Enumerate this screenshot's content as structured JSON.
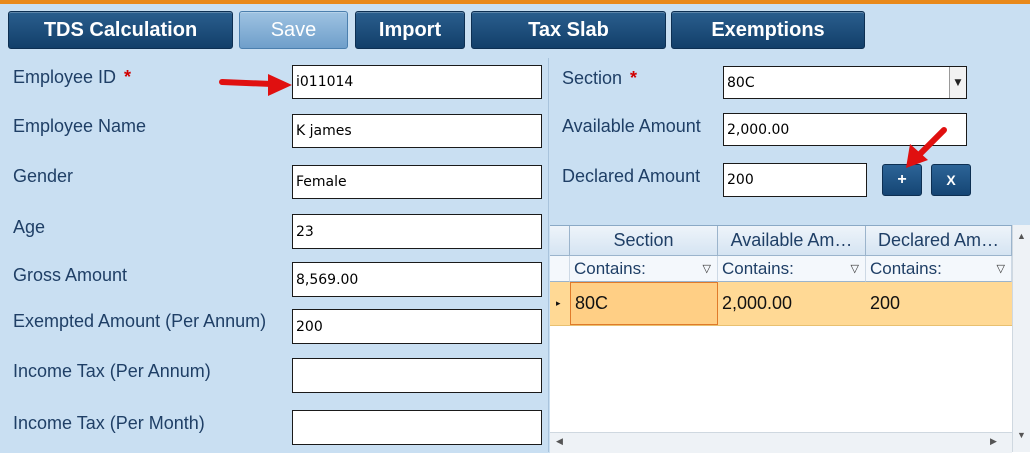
{
  "toolbar": {
    "tds_label": "TDS Calculation",
    "save_label": "Save",
    "import_label": "Import",
    "taxslab_label": "Tax Slab",
    "exemptions_label": "Exemptions"
  },
  "employee": {
    "id_label": "Employee ID",
    "id_value": "i011014",
    "name_label": "Employee Name",
    "name_value": "K  james",
    "gender_label": "Gender",
    "gender_value": "Female",
    "age_label": "Age",
    "age_value": "23",
    "gross_label": "Gross Amount",
    "gross_value": "8,569.00",
    "exempted_label": "Exempted Amount (Per Annum)",
    "exempted_value": "200",
    "income_annum_label": "Income Tax (Per Annum)",
    "income_annum_value": "",
    "income_month_label": "Income Tax (Per Month)",
    "income_month_value": ""
  },
  "required_mark": "*",
  "exemption": {
    "section_label": "Section",
    "section_value": "80C",
    "available_label": "Available Amount",
    "available_value": "2,000.00",
    "declared_label": "Declared Amount",
    "declared_value": "200",
    "add_label": "+",
    "remove_label": "X"
  },
  "grid": {
    "columns": [
      "Section",
      "Available Am…",
      "Declared Am…"
    ],
    "filter_label": "Contains:",
    "rows": [
      {
        "section": "80C",
        "available": "2,000.00",
        "declared": "200"
      }
    ]
  },
  "colors": {
    "accent_orange": "#e8891b",
    "button_blue": "#154574",
    "selected_row": "#ffd995",
    "required_red": "#d10000"
  }
}
